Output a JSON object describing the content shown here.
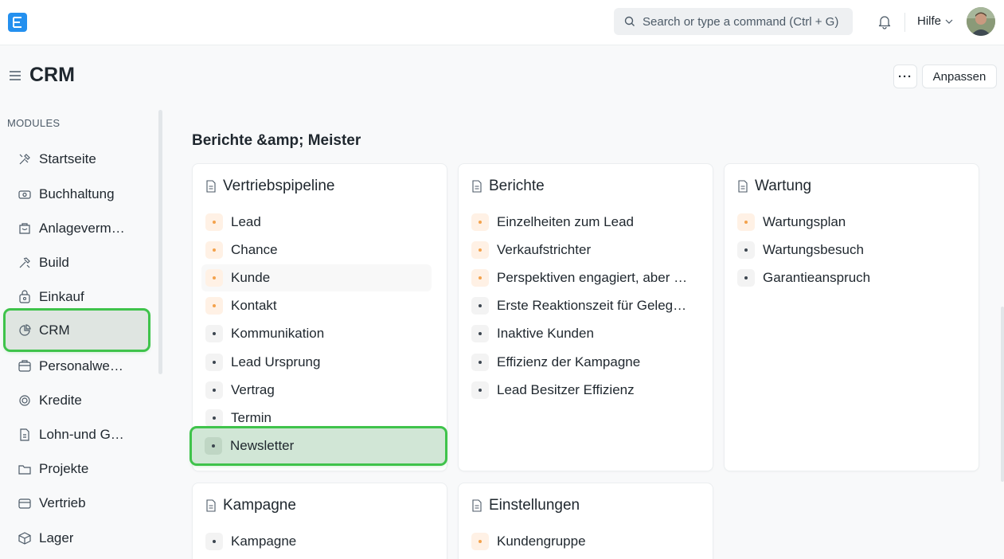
{
  "navbar": {
    "logo_letter": "E",
    "search_placeholder": "Search or type a command (Ctrl + G)",
    "help_label": "Hilfe"
  },
  "page": {
    "title": "CRM",
    "more_label": "···",
    "customize_label": "Anpassen"
  },
  "sidebar": {
    "heading": "MODULES",
    "items": [
      {
        "label": "Startseite",
        "icon": "tools-icon"
      },
      {
        "label": "Buchhaltung",
        "icon": "money-icon"
      },
      {
        "label": "Anlagevermögen",
        "icon": "asset-icon"
      },
      {
        "label": "Build",
        "icon": "hammer-icon"
      },
      {
        "label": "Einkauf",
        "icon": "shopping-bag-icon"
      },
      {
        "label": "CRM",
        "icon": "pie-chart-icon",
        "active": true
      },
      {
        "label": "Personalwesen",
        "icon": "id-card-icon"
      },
      {
        "label": "Kredite",
        "icon": "loan-icon"
      },
      {
        "label": "Lohn-und Gehaltsabrechnung",
        "icon": "payroll-icon"
      },
      {
        "label": "Projekte",
        "icon": "folder-icon"
      },
      {
        "label": "Vertrieb",
        "icon": "sales-icon"
      },
      {
        "label": "Lager",
        "icon": "box-icon"
      }
    ]
  },
  "content": {
    "section_title": "Berichte &amp; Meister",
    "cards": [
      {
        "title": "Vertriebspipeline",
        "links": [
          {
            "label": "Lead",
            "dot": "orange"
          },
          {
            "label": "Chance",
            "dot": "orange"
          },
          {
            "label": "Kunde",
            "dot": "orange"
          },
          {
            "label": "Kontakt",
            "dot": "orange"
          },
          {
            "label": "Kommunikation",
            "dot": "gray"
          },
          {
            "label": "Lead Ursprung",
            "dot": "gray"
          },
          {
            "label": "Vertrag",
            "dot": "gray"
          },
          {
            "label": "Termin",
            "dot": "gray"
          },
          {
            "label": "Newsletter",
            "dot": "gray"
          }
        ]
      },
      {
        "title": "Berichte",
        "links": [
          {
            "label": "Einzelheiten zum Lead",
            "dot": "orange"
          },
          {
            "label": "Verkaufstrichter",
            "dot": "orange"
          },
          {
            "label": "Perspektiven engagiert, aber nicht umgewandelt",
            "dot": "orange"
          },
          {
            "label": "Erste Reaktionszeit für Gelegenheit",
            "dot": "gray"
          },
          {
            "label": "Inaktive Kunden",
            "dot": "gray"
          },
          {
            "label": "Effizienz der Kampagne",
            "dot": "gray"
          },
          {
            "label": "Lead Besitzer Effizienz",
            "dot": "gray"
          }
        ]
      },
      {
        "title": "Wartung",
        "links": [
          {
            "label": "Wartungsplan",
            "dot": "orange"
          },
          {
            "label": "Wartungsbesuch",
            "dot": "gray"
          },
          {
            "label": "Garantieanspruch",
            "dot": "gray"
          }
        ]
      },
      {
        "title": "Kampagne",
        "links": [
          {
            "label": "Kampagne",
            "dot": "gray"
          }
        ]
      },
      {
        "title": "Einstellungen",
        "links": [
          {
            "label": "Kundengruppe",
            "dot": "orange"
          }
        ]
      }
    ]
  },
  "colors": {
    "brand": "#2490ef",
    "highlight": "#3fc34b",
    "dot_orange": "#f4a24c"
  }
}
